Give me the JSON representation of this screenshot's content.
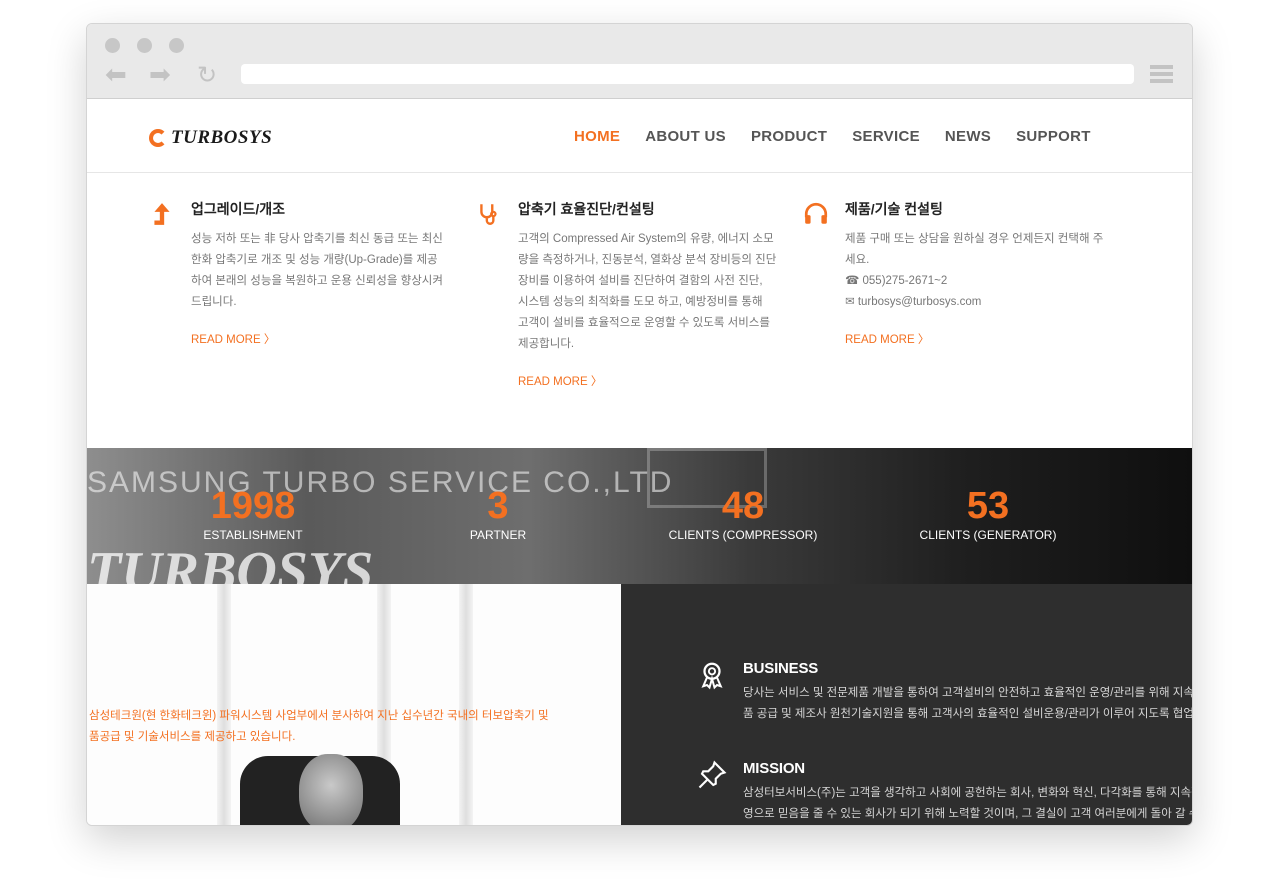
{
  "browser": {
    "url": ""
  },
  "header": {
    "logo_text": "TURBOSYS",
    "nav": [
      {
        "label": "HOME",
        "active": true
      },
      {
        "label": "ABOUT US",
        "active": false
      },
      {
        "label": "PRODUCT",
        "active": false
      },
      {
        "label": "SERVICE",
        "active": false
      },
      {
        "label": "NEWS",
        "active": false
      },
      {
        "label": "SUPPORT",
        "active": false
      }
    ]
  },
  "services": [
    {
      "icon": "arrow-up-icon",
      "title": "업그레이드/개조",
      "lines": [
        "성능 저하 또는 非 당사 압축기를 최신 동급 또는 최신",
        "한화 압축기로 개조 및 성능 개량(Up-Grade)를 제공",
        "하여 본래의 성능을 복원하고 운용 신뢰성을 향상시켜",
        "드립니다."
      ],
      "readmore": "READ MORE 〉"
    },
    {
      "icon": "stethoscope-icon",
      "title": "압축기 효율진단/컨설팅",
      "lines": [
        "고객의 Compressed Air System의 유량, 에너지 소모",
        "량을 측정하거나, 진동분석, 열화상 분석 장비등의 진단",
        "장비를 이용하여 설비를  진단하여 결함의 사전 진단,",
        "시스템 성능의  최적화를 도모 하고,  예방정비를 통해",
        "고객이 설비를 효율적으로 운영할 수 있도록 서비스를",
        "제공합니다."
      ],
      "readmore": "READ MORE 〉"
    },
    {
      "icon": "headphones-icon",
      "title": "제품/기술 컨설팅",
      "lines": [
        "제품 구매 또는 상담을 원하실 경우 언제든지 컨택해 주",
        "세요.",
        "☎ 055)275-2671~2",
        "✉ turbosys@turbosys.com"
      ],
      "readmore": "READ MORE 〉"
    }
  ],
  "stats": {
    "bg_text": "SAMSUNG TURBO SERVICE CO.,LTD",
    "bg_logo": "TURBOSYS",
    "items": [
      {
        "value": "1998",
        "label": "ESTABLISHMENT"
      },
      {
        "value": "3",
        "label": "PARTNER"
      },
      {
        "value": "48",
        "label": "CLIENTS (COMPRESSOR)"
      },
      {
        "value": "53",
        "label": "CLIENTS (GENERATOR)"
      }
    ]
  },
  "intro": {
    "line1": "삼성테크원(현 한화테크윈) 파워시스템 사업부에서 분사하여 지난 십수년간 국내의 터보압축기 및",
    "line2": "품공급 및 기술서비스를 제공하고 있습니다."
  },
  "business": {
    "title": "BUSINESS",
    "line1": "당사는 서비스 및 전문제품 개발을 통하여 고객설비의 안전하고 효율적인 운영/관리를 위해 지속적으",
    "line2": "품 공급 및 제조사 원천기술지원을 통해 고객사의 효율적인 설비운용/관리가 이루어 지도록 협업하고"
  },
  "mission": {
    "title": "MISSION",
    "line1": "삼성터보서비스(주)는 고객을 생각하고 사회에 공헌하는 회사, 변화와 혁신, 다각화를 통해 지속적으",
    "line2": "영으로 믿음을 줄 수 있는 회사가 되기 위해 노력할 것이며, 그 결실이 고객 여러분에게 돌아 갈 수 있"
  }
}
